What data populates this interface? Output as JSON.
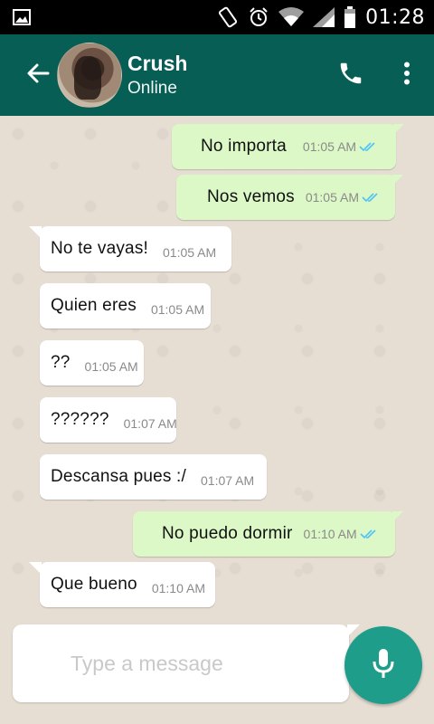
{
  "status_bar": {
    "time": "01:28",
    "icons": [
      "image-icon",
      "vibrate-icon",
      "alarm-icon",
      "wifi-icon",
      "signal-icon",
      "battery-icon"
    ]
  },
  "header": {
    "contact_name": "Crush",
    "status": "Online",
    "icons": [
      "back-arrow-icon",
      "phone-icon",
      "more-vert-icon"
    ],
    "color": "#075e54"
  },
  "messages": [
    {
      "direction": "out",
      "text": "No importa",
      "time": "01:05 AM",
      "read": true
    },
    {
      "direction": "out",
      "text": "Nos vemos",
      "time": "01:05 AM",
      "read": true
    },
    {
      "direction": "in",
      "text": "No te vayas!",
      "time": "01:05 AM"
    },
    {
      "direction": "in",
      "text": "Quien eres",
      "time": "01:05 AM"
    },
    {
      "direction": "in",
      "text": "??",
      "time": "01:05 AM"
    },
    {
      "direction": "in",
      "text": "??????",
      "time": "01:07 AM"
    },
    {
      "direction": "in",
      "text": "Descansa pues :/",
      "time": "01:07 AM"
    },
    {
      "direction": "out",
      "text": "No puedo dormir",
      "time": "01:10 AM",
      "read": true
    },
    {
      "direction": "in",
      "text": "Que bueno",
      "time": "01:10 AM"
    }
  ],
  "composer": {
    "placeholder": "Type a message",
    "icon": "mic-icon"
  },
  "colors": {
    "outgoing_bubble": "#dcf8c6",
    "incoming_bubble": "#ffffff",
    "read_ticks": "#4fc3f7",
    "accent": "#1e9e8a"
  }
}
